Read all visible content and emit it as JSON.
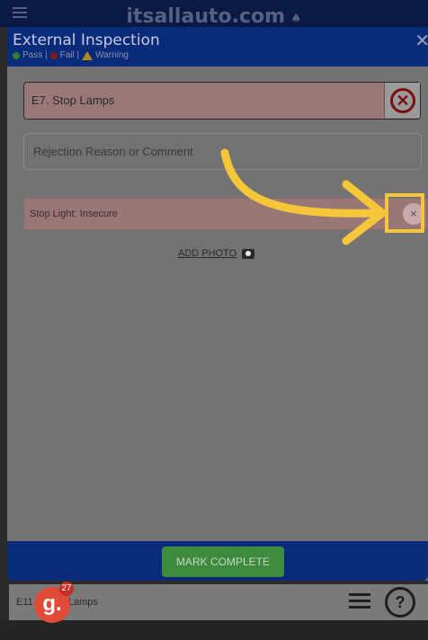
{
  "app": {
    "brand": "itsallauto.com"
  },
  "modal": {
    "title": "External Inspection",
    "legend": {
      "pass": "Pass |",
      "fail": "Fail |",
      "warning": "Warning"
    },
    "item_label": "E7. Stop Lamps",
    "comment_placeholder": "Rejection Reason or Comment",
    "reason_tag": "Stop Light: Insecure",
    "reason_close_glyph": "×",
    "add_photo_label": "ADD PHOTO",
    "mark_complete_label": "MARK COMPLETE"
  },
  "background": {
    "bottom_row_text": "E11",
    "bottom_row_suffix": "Lamps",
    "help_glyph": "?"
  },
  "badge": {
    "letter": "g.",
    "count": "27"
  },
  "colors": {
    "accent_yellow": "#f5c53a",
    "header_blue": "#0a2a7a",
    "fail_red": "#7a0f0f",
    "complete_green": "#3e8a3e"
  }
}
